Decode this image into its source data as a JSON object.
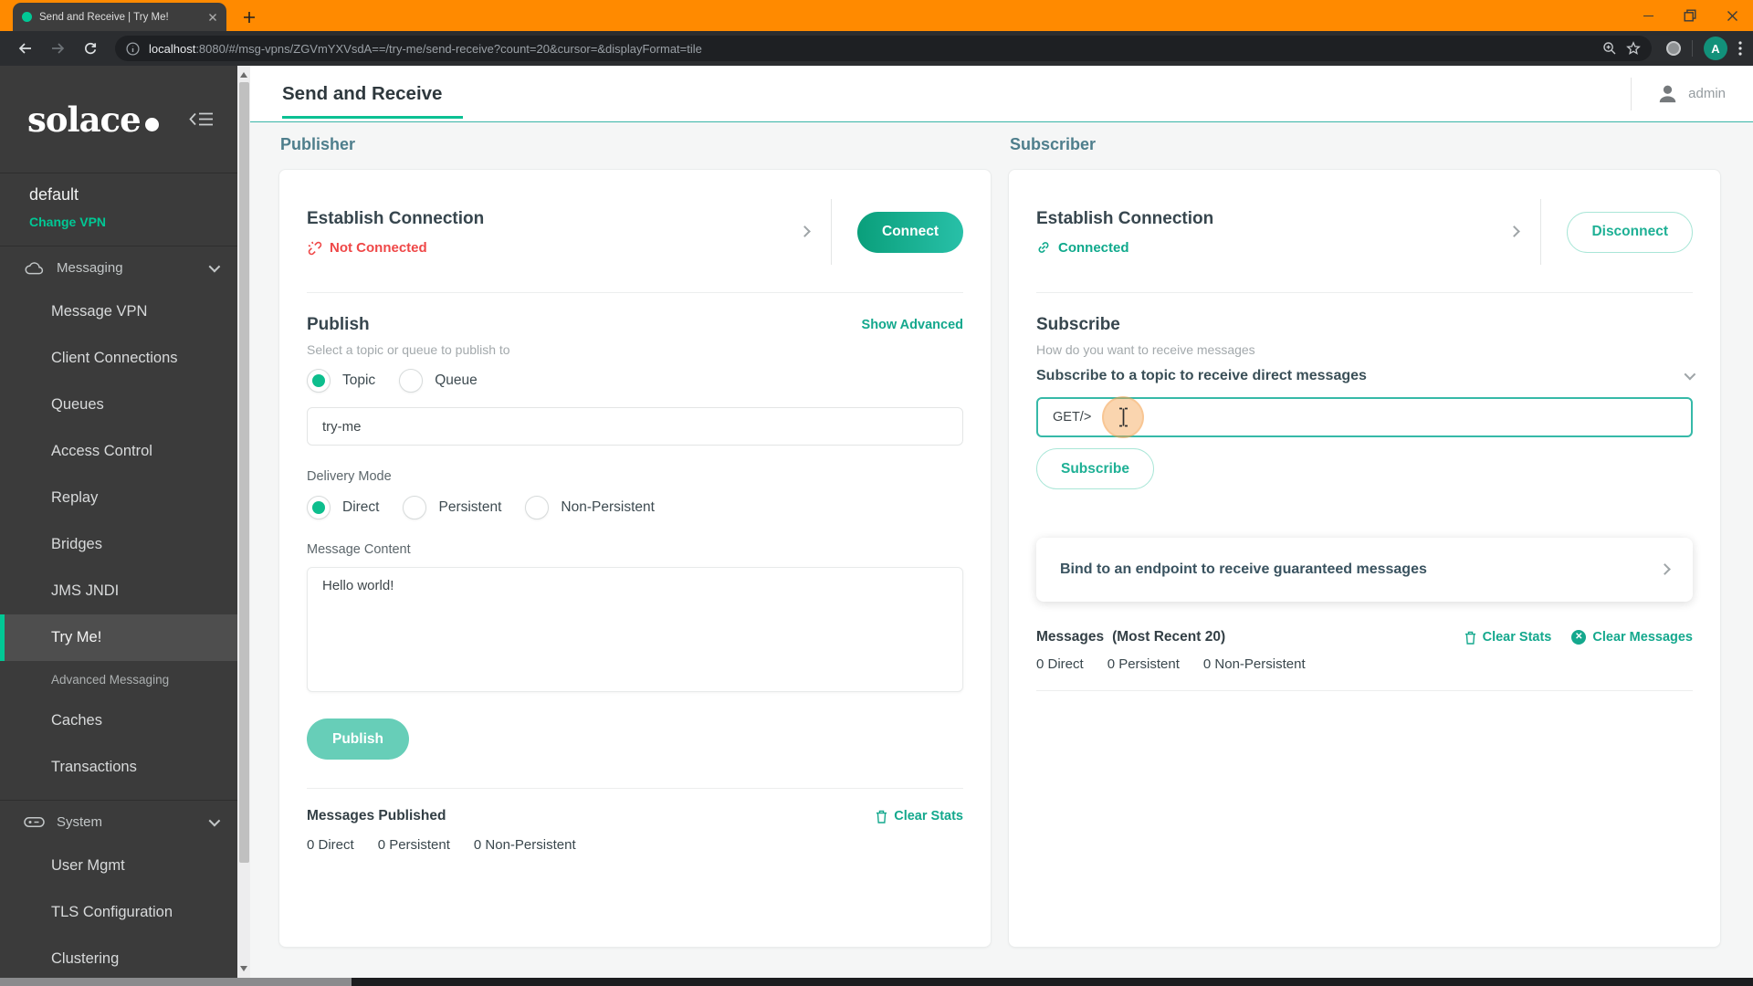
{
  "colors": {
    "accent_teal": "#14A88D",
    "accent_green": "#00C895",
    "status_red": "#EF4747",
    "titlebar_orange": "#FF8A00"
  },
  "browser": {
    "tab_title": "Send and Receive | Try Me!",
    "url_host": "localhost",
    "url_rest": ":8080/#/msg-vpns/ZGVmYXVsdA==/try-me/send-receive?count=20&cursor=&displayFormat=tile",
    "profile_initial": "A"
  },
  "sidebar": {
    "logo_text": "solace",
    "vpn_name": "default",
    "change_vpn_label": "Change VPN",
    "messaging": {
      "label": "Messaging",
      "items": [
        {
          "label": "Message VPN"
        },
        {
          "label": "Client Connections"
        },
        {
          "label": "Queues"
        },
        {
          "label": "Access Control"
        },
        {
          "label": "Replay"
        },
        {
          "label": "Bridges"
        },
        {
          "label": "JMS JNDI"
        },
        {
          "label": "Try Me!"
        },
        {
          "label": "Advanced Messaging"
        },
        {
          "label": "Caches"
        },
        {
          "label": "Transactions"
        }
      ]
    },
    "system": {
      "label": "System",
      "items": [
        {
          "label": "User Mgmt"
        },
        {
          "label": "TLS Configuration"
        },
        {
          "label": "Clustering"
        }
      ]
    },
    "active_item": "Try Me!"
  },
  "header": {
    "title": "Send and Receive",
    "user_name": "admin"
  },
  "publisher": {
    "section_label": "Publisher",
    "connection": {
      "title": "Establish Connection",
      "status": "Not Connected",
      "action_label": "Connect"
    },
    "publish": {
      "title": "Publish",
      "subtitle": "Select a topic or queue to publish to",
      "advanced_link": "Show Advanced",
      "destination_options": [
        {
          "label": "Topic",
          "selected": true
        },
        {
          "label": "Queue",
          "selected": false
        }
      ],
      "topic_value": "try-me",
      "delivery_label": "Delivery Mode",
      "delivery_options": [
        {
          "label": "Direct",
          "selected": true
        },
        {
          "label": "Persistent",
          "selected": false
        },
        {
          "label": "Non-Persistent",
          "selected": false
        }
      ],
      "message_label": "Message Content",
      "message_value": "Hello world!",
      "publish_label": "Publish"
    },
    "stats": {
      "title": "Messages Published",
      "clear_stats_label": "Clear Stats",
      "values": [
        "0 Direct",
        "0 Persistent",
        "0 Non-Persistent"
      ]
    }
  },
  "subscriber": {
    "section_label": "Subscriber",
    "connection": {
      "title": "Establish Connection",
      "status": "Connected",
      "action_label": "Disconnect"
    },
    "subscribe": {
      "title": "Subscribe",
      "subtitle": "How do you want to receive messages",
      "direct_header": "Subscribe to a topic to receive direct messages",
      "topic_value": "GET/>",
      "subscribe_label": "Subscribe"
    },
    "bind_header": "Bind to an endpoint to receive guaranteed messages",
    "stats": {
      "title": "Messages",
      "subtitle": "(Most Recent 20)",
      "clear_stats_label": "Clear Stats",
      "clear_messages_label": "Clear Messages",
      "values": [
        "0 Direct",
        "0 Persistent",
        "0 Non-Persistent"
      ]
    }
  }
}
